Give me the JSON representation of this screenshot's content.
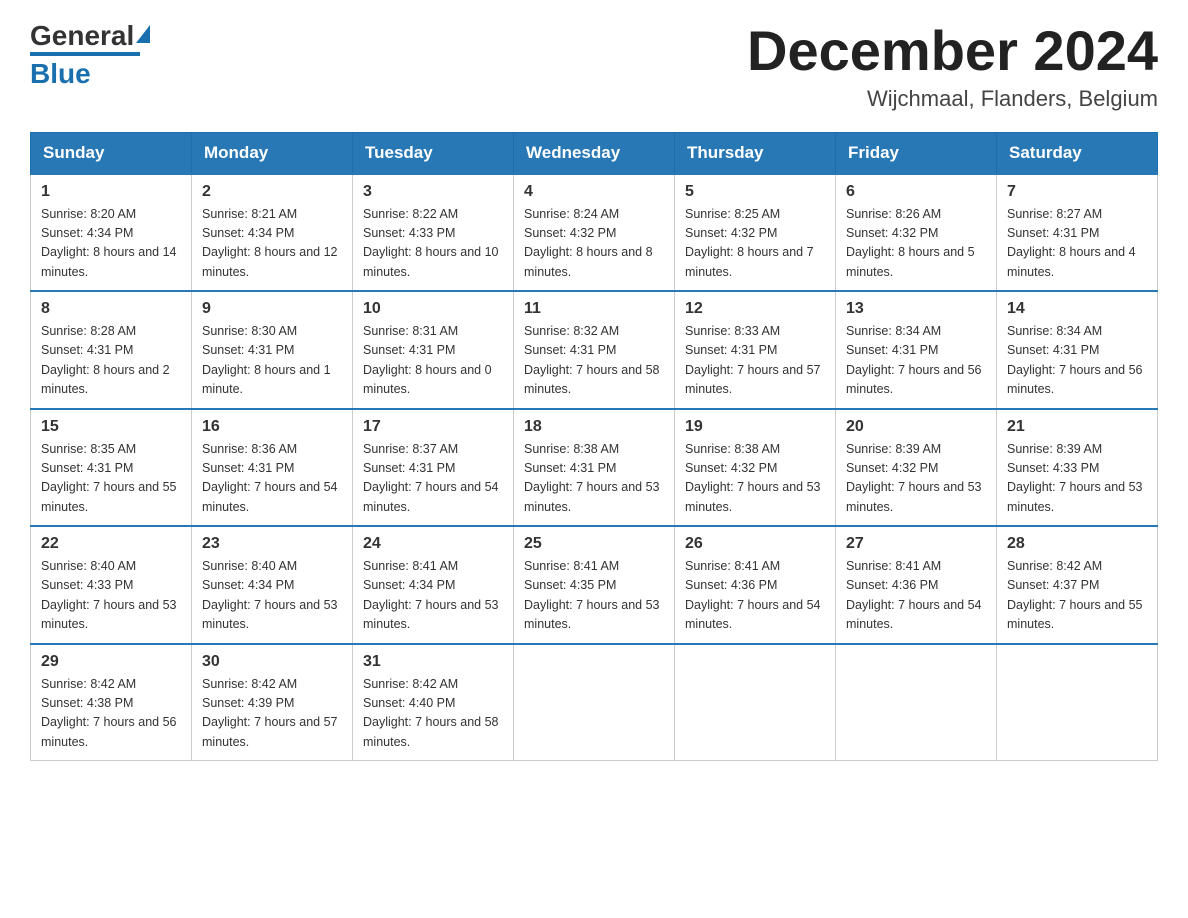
{
  "header": {
    "logo_general": "General",
    "logo_blue": "Blue",
    "month_title": "December 2024",
    "location": "Wijchmaal, Flanders, Belgium"
  },
  "days_of_week": [
    "Sunday",
    "Monday",
    "Tuesday",
    "Wednesday",
    "Thursday",
    "Friday",
    "Saturday"
  ],
  "weeks": [
    [
      {
        "day": "1",
        "sunrise": "8:20 AM",
        "sunset": "4:34 PM",
        "daylight": "8 hours and 14 minutes."
      },
      {
        "day": "2",
        "sunrise": "8:21 AM",
        "sunset": "4:34 PM",
        "daylight": "8 hours and 12 minutes."
      },
      {
        "day": "3",
        "sunrise": "8:22 AM",
        "sunset": "4:33 PM",
        "daylight": "8 hours and 10 minutes."
      },
      {
        "day": "4",
        "sunrise": "8:24 AM",
        "sunset": "4:32 PM",
        "daylight": "8 hours and 8 minutes."
      },
      {
        "day": "5",
        "sunrise": "8:25 AM",
        "sunset": "4:32 PM",
        "daylight": "8 hours and 7 minutes."
      },
      {
        "day": "6",
        "sunrise": "8:26 AM",
        "sunset": "4:32 PM",
        "daylight": "8 hours and 5 minutes."
      },
      {
        "day": "7",
        "sunrise": "8:27 AM",
        "sunset": "4:31 PM",
        "daylight": "8 hours and 4 minutes."
      }
    ],
    [
      {
        "day": "8",
        "sunrise": "8:28 AM",
        "sunset": "4:31 PM",
        "daylight": "8 hours and 2 minutes."
      },
      {
        "day": "9",
        "sunrise": "8:30 AM",
        "sunset": "4:31 PM",
        "daylight": "8 hours and 1 minute."
      },
      {
        "day": "10",
        "sunrise": "8:31 AM",
        "sunset": "4:31 PM",
        "daylight": "8 hours and 0 minutes."
      },
      {
        "day": "11",
        "sunrise": "8:32 AM",
        "sunset": "4:31 PM",
        "daylight": "7 hours and 58 minutes."
      },
      {
        "day": "12",
        "sunrise": "8:33 AM",
        "sunset": "4:31 PM",
        "daylight": "7 hours and 57 minutes."
      },
      {
        "day": "13",
        "sunrise": "8:34 AM",
        "sunset": "4:31 PM",
        "daylight": "7 hours and 56 minutes."
      },
      {
        "day": "14",
        "sunrise": "8:34 AM",
        "sunset": "4:31 PM",
        "daylight": "7 hours and 56 minutes."
      }
    ],
    [
      {
        "day": "15",
        "sunrise": "8:35 AM",
        "sunset": "4:31 PM",
        "daylight": "7 hours and 55 minutes."
      },
      {
        "day": "16",
        "sunrise": "8:36 AM",
        "sunset": "4:31 PM",
        "daylight": "7 hours and 54 minutes."
      },
      {
        "day": "17",
        "sunrise": "8:37 AM",
        "sunset": "4:31 PM",
        "daylight": "7 hours and 54 minutes."
      },
      {
        "day": "18",
        "sunrise": "8:38 AM",
        "sunset": "4:31 PM",
        "daylight": "7 hours and 53 minutes."
      },
      {
        "day": "19",
        "sunrise": "8:38 AM",
        "sunset": "4:32 PM",
        "daylight": "7 hours and 53 minutes."
      },
      {
        "day": "20",
        "sunrise": "8:39 AM",
        "sunset": "4:32 PM",
        "daylight": "7 hours and 53 minutes."
      },
      {
        "day": "21",
        "sunrise": "8:39 AM",
        "sunset": "4:33 PM",
        "daylight": "7 hours and 53 minutes."
      }
    ],
    [
      {
        "day": "22",
        "sunrise": "8:40 AM",
        "sunset": "4:33 PM",
        "daylight": "7 hours and 53 minutes."
      },
      {
        "day": "23",
        "sunrise": "8:40 AM",
        "sunset": "4:34 PM",
        "daylight": "7 hours and 53 minutes."
      },
      {
        "day": "24",
        "sunrise": "8:41 AM",
        "sunset": "4:34 PM",
        "daylight": "7 hours and 53 minutes."
      },
      {
        "day": "25",
        "sunrise": "8:41 AM",
        "sunset": "4:35 PM",
        "daylight": "7 hours and 53 minutes."
      },
      {
        "day": "26",
        "sunrise": "8:41 AM",
        "sunset": "4:36 PM",
        "daylight": "7 hours and 54 minutes."
      },
      {
        "day": "27",
        "sunrise": "8:41 AM",
        "sunset": "4:36 PM",
        "daylight": "7 hours and 54 minutes."
      },
      {
        "day": "28",
        "sunrise": "8:42 AM",
        "sunset": "4:37 PM",
        "daylight": "7 hours and 55 minutes."
      }
    ],
    [
      {
        "day": "29",
        "sunrise": "8:42 AM",
        "sunset": "4:38 PM",
        "daylight": "7 hours and 56 minutes."
      },
      {
        "day": "30",
        "sunrise": "8:42 AM",
        "sunset": "4:39 PM",
        "daylight": "7 hours and 57 minutes."
      },
      {
        "day": "31",
        "sunrise": "8:42 AM",
        "sunset": "4:40 PM",
        "daylight": "7 hours and 58 minutes."
      },
      null,
      null,
      null,
      null
    ]
  ]
}
